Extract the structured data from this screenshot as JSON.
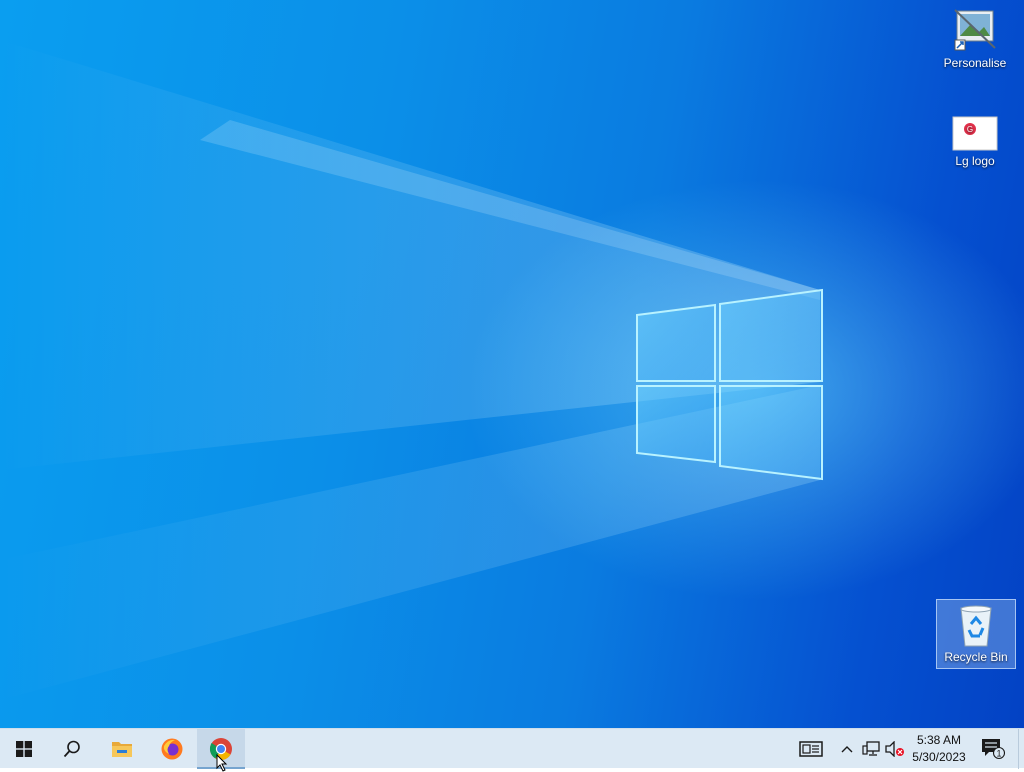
{
  "desktop": {
    "icons": [
      {
        "label": "Personalise",
        "icon": "personalise-shortcut-icon"
      },
      {
        "label": "Lg logo",
        "icon": "image-file-icon"
      },
      {
        "label": "Recycle Bin",
        "icon": "recycle-bin-icon"
      }
    ]
  },
  "taskbar": {
    "buttons": [
      {
        "name": "start",
        "icon": "windows-logo-icon"
      },
      {
        "name": "search",
        "icon": "search-icon"
      },
      {
        "name": "file-explorer",
        "icon": "folder-icon"
      },
      {
        "name": "firefox",
        "icon": "firefox-icon"
      },
      {
        "name": "chrome",
        "icon": "chrome-icon",
        "active": true
      }
    ],
    "tray": {
      "icons": [
        "news-widget-icon",
        "chevron-up-icon",
        "network-icon",
        "volume-muted-icon"
      ],
      "time": "5:38 AM",
      "date": "5/30/2023",
      "notification_count": "1"
    }
  },
  "colors": {
    "taskbar": "#dce9f4",
    "wallpaper_light": "#0a9ef0",
    "wallpaper_dark": "#0342c4"
  }
}
